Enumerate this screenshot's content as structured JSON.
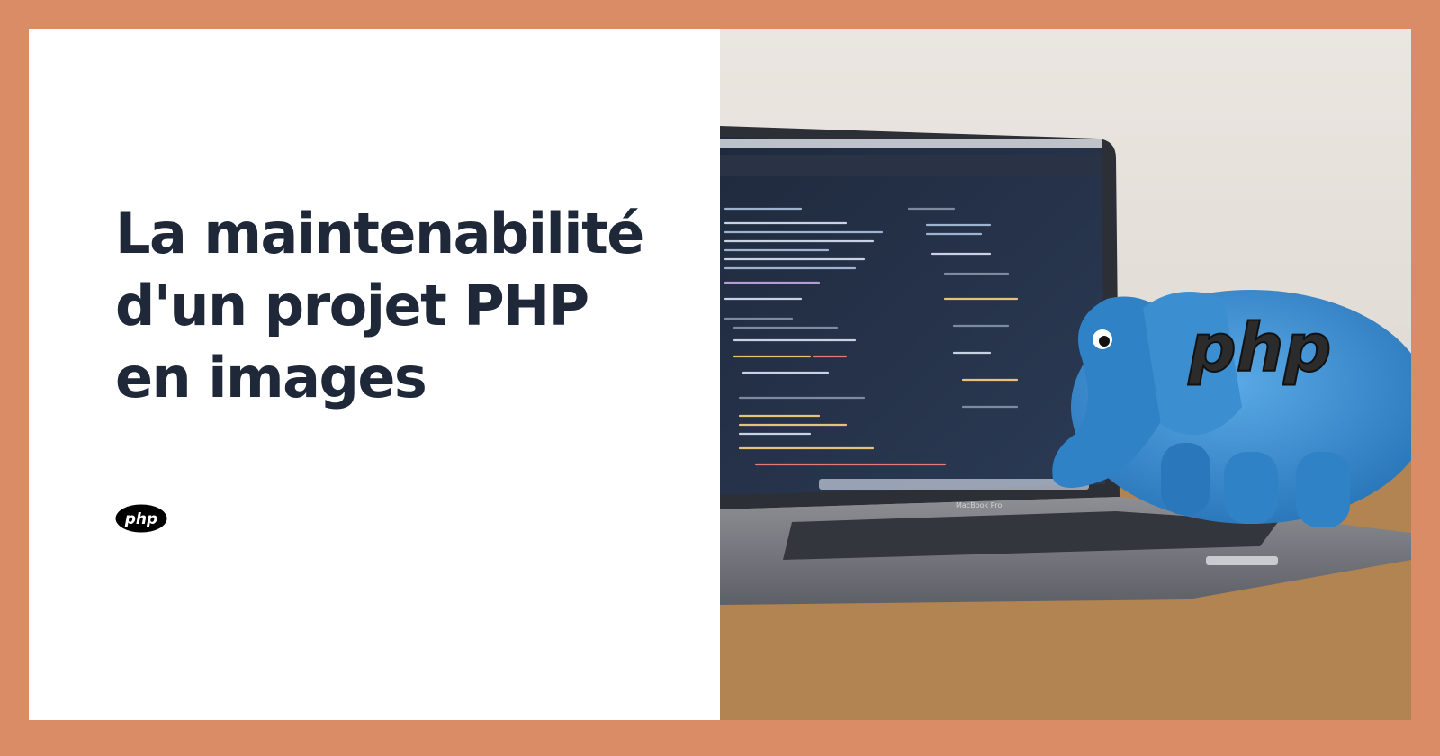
{
  "card": {
    "title_lines": [
      "La maintenabilité",
      "d'un projet PHP",
      "en images"
    ],
    "logo_text": "php"
  },
  "photo": {
    "laptop_brand": "MacBook Pro",
    "plush_text": "php"
  },
  "colors": {
    "border": "#d98c66",
    "title": "#1f2838",
    "panel": "#ffffff",
    "plush_blue": "#3b8fd0"
  }
}
